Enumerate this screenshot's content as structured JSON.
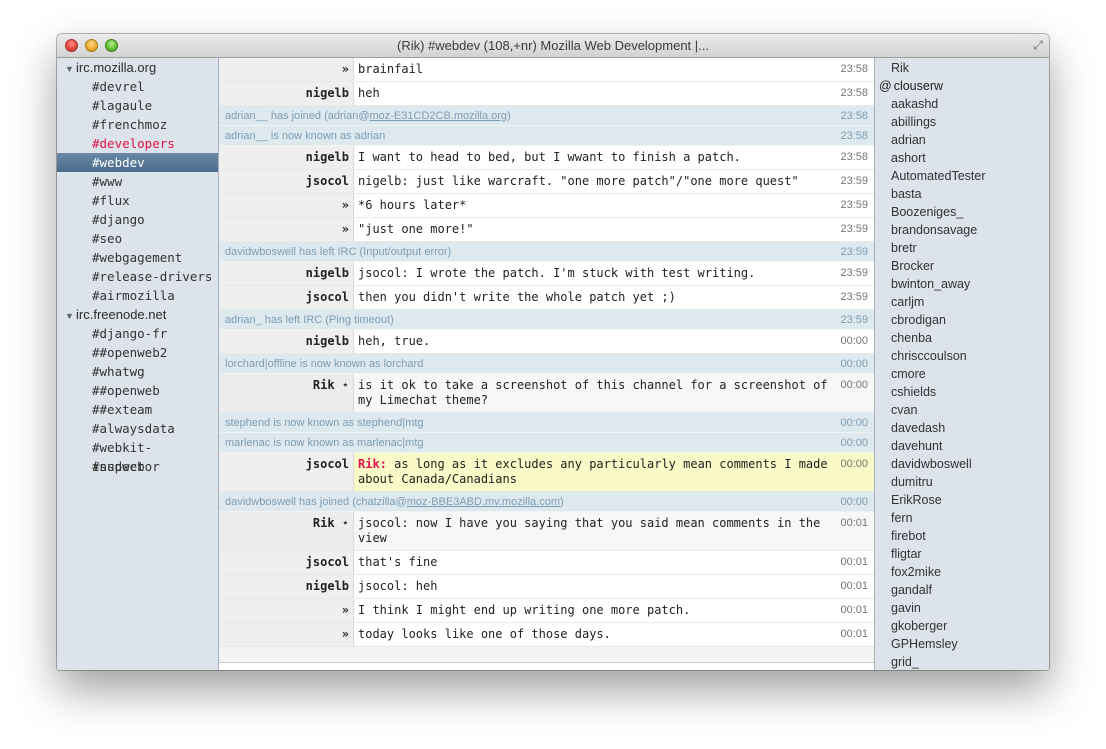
{
  "window": {
    "title": "(Rik) #webdev (108,+nr) Mozilla Web Development |..."
  },
  "sidebar": {
    "servers": [
      {
        "name": "irc.mozilla.org",
        "channels": [
          "#devrel",
          "#lagaule",
          "#frenchmoz",
          "#developers",
          "#webdev",
          "#www",
          "#flux",
          "#django",
          "#seo",
          "#webgagement",
          "#release-drivers",
          "#airmozilla"
        ]
      },
      {
        "name": "irc.freenode.net",
        "channels": [
          "#django-fr",
          "##openweb2",
          "#whatwg",
          "##openweb",
          "##exteam",
          "#alwaysdata",
          "#webkit-inspector",
          "#sudweb"
        ]
      }
    ],
    "highlighted_channel": "#developers",
    "active_channel": "#webdev"
  },
  "chat": {
    "lines": [
      {
        "kind": "msg",
        "nick": "»",
        "text": "brainfail",
        "time": "23:58"
      },
      {
        "kind": "msg",
        "nick": "nigelb",
        "text": "heh",
        "time": "23:58"
      },
      {
        "kind": "sys",
        "text": "adrian__ has joined (adrian@",
        "link": "moz-E31CD2CB.mozilla.org",
        "tail": ")",
        "time": "23:58"
      },
      {
        "kind": "sys",
        "text": "adrian__ is now known as adrian",
        "time": "23:58"
      },
      {
        "kind": "msg",
        "nick": "nigelb",
        "text": "I want to head to bed, but I wwant to finish a patch.",
        "time": "23:58"
      },
      {
        "kind": "msg",
        "nick": "jsocol",
        "text": "nigelb: just like warcraft. \"one more patch\"/\"one more quest\"",
        "time": "23:59"
      },
      {
        "kind": "msg",
        "nick": "»",
        "text": "*6 hours later*",
        "time": "23:59"
      },
      {
        "kind": "msg",
        "nick": "»",
        "text": "\"just one more!\"",
        "time": "23:59"
      },
      {
        "kind": "sys",
        "text": "davidwboswell has left IRC (Input/output error)",
        "time": "23:59"
      },
      {
        "kind": "msg",
        "nick": "nigelb",
        "text": "jsocol: I wrote the patch. I'm stuck with test writing.",
        "time": "23:59"
      },
      {
        "kind": "msg",
        "nick": "jsocol",
        "text": "then you didn't write the whole patch yet ;)",
        "time": "23:59"
      },
      {
        "kind": "sys",
        "text": "adrian_ has left IRC (Ping timeout)",
        "time": "23:59"
      },
      {
        "kind": "msg",
        "nick": "nigelb",
        "text": "heh, true.",
        "time": "00:00"
      },
      {
        "kind": "sys",
        "text": "lorchard|offline is now known as lorchard",
        "time": "00:00"
      },
      {
        "kind": "me",
        "nick": "Rik ⋆",
        "text": "is it ok to take a screenshot of this channel for a screenshot of my Limechat theme?",
        "time": "00:00"
      },
      {
        "kind": "sys",
        "text": "stephend is now known as stephend|mtg",
        "time": "00:00"
      },
      {
        "kind": "sys",
        "text": "marlenac is now known as marlenac|mtg",
        "time": "00:00"
      },
      {
        "kind": "mention",
        "nick": "jsocol",
        "mention": "Rik:",
        "text": " as long as it excludes any particularly mean comments I made about Canada/Canadians",
        "time": "00:00"
      },
      {
        "kind": "sys",
        "text": "davidwboswell has joined (chatzilla@",
        "link": "moz-BBE3ABD.mv.mozilla.com",
        "tail": ")",
        "time": "00:00"
      },
      {
        "kind": "me",
        "nick": "Rik ⋆",
        "text": "jsocol: now I have you saying that you said mean comments in the view",
        "time": "00:01"
      },
      {
        "kind": "msg",
        "nick": "jsocol",
        "text": "that's fine",
        "time": "00:01"
      },
      {
        "kind": "msg",
        "nick": "nigelb",
        "text": "jsocol: heh",
        "time": "00:01"
      },
      {
        "kind": "msg",
        "nick": "»",
        "text": "I think I might end up writing one more patch.",
        "time": "00:01"
      },
      {
        "kind": "msg",
        "nick": "»",
        "text": "today looks like one of those days.",
        "time": "00:01"
      }
    ]
  },
  "members": {
    "self": "Rik",
    "op": {
      "prefix": "@",
      "name": "clouserw"
    },
    "users": [
      "aakashd",
      "abillings",
      "adrian",
      "ashort",
      "AutomatedTester",
      "basta",
      "Boozeniges_",
      "brandonsavage",
      "bretr",
      "Brocker",
      "bwinton_away",
      "carljm",
      "cbrodigan",
      "chenba",
      "chrisccoulson",
      "cmore",
      "cshields",
      "cvan",
      "davedash",
      "davehunt",
      "davidwboswell",
      "dumitru",
      "ErikRose",
      "fern",
      "firebot",
      "fligtar",
      "fox2mike",
      "gandalf",
      "gavin",
      "gkoberger",
      "GPHemsley",
      "grid_"
    ]
  },
  "colors": {
    "sidebar_bg": "#dce3ea",
    "active_channel_bg": "#4a6c8c",
    "highlight_channel": "#e0114a",
    "system_line_bg": "#dde8ef",
    "system_text": "#7f9db3",
    "mention_bg": "#fafac8"
  }
}
